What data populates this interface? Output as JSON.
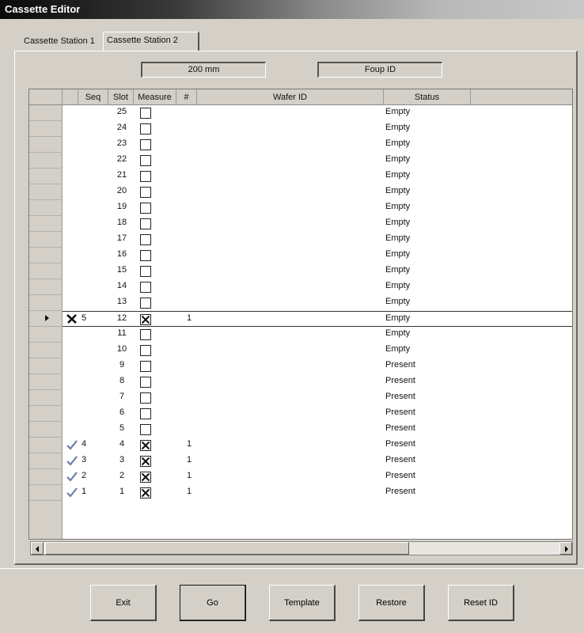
{
  "window": {
    "title": "Cassette Editor"
  },
  "tabs": [
    {
      "label": "Cassette Station 1"
    },
    {
      "label": "Cassette Station 2"
    }
  ],
  "header_fields": {
    "wafer_size": "200 mm",
    "foup_id": "Foup ID"
  },
  "grid": {
    "columns": [
      "Seq",
      "Slot",
      "Measure",
      "#",
      "Wafer ID",
      "Status"
    ],
    "rows": [
      {
        "seq_icon": "",
        "seq": "",
        "slot": "25",
        "measure": false,
        "num": "",
        "wafer_id": "",
        "status": "Empty",
        "selected": false
      },
      {
        "seq_icon": "",
        "seq": "",
        "slot": "24",
        "measure": false,
        "num": "",
        "wafer_id": "",
        "status": "Empty",
        "selected": false
      },
      {
        "seq_icon": "",
        "seq": "",
        "slot": "23",
        "measure": false,
        "num": "",
        "wafer_id": "",
        "status": "Empty",
        "selected": false
      },
      {
        "seq_icon": "",
        "seq": "",
        "slot": "22",
        "measure": false,
        "num": "",
        "wafer_id": "",
        "status": "Empty",
        "selected": false
      },
      {
        "seq_icon": "",
        "seq": "",
        "slot": "21",
        "measure": false,
        "num": "",
        "wafer_id": "",
        "status": "Empty",
        "selected": false
      },
      {
        "seq_icon": "",
        "seq": "",
        "slot": "20",
        "measure": false,
        "num": "",
        "wafer_id": "",
        "status": "Empty",
        "selected": false
      },
      {
        "seq_icon": "",
        "seq": "",
        "slot": "19",
        "measure": false,
        "num": "",
        "wafer_id": "",
        "status": "Empty",
        "selected": false
      },
      {
        "seq_icon": "",
        "seq": "",
        "slot": "18",
        "measure": false,
        "num": "",
        "wafer_id": "",
        "status": "Empty",
        "selected": false
      },
      {
        "seq_icon": "",
        "seq": "",
        "slot": "17",
        "measure": false,
        "num": "",
        "wafer_id": "",
        "status": "Empty",
        "selected": false
      },
      {
        "seq_icon": "",
        "seq": "",
        "slot": "16",
        "measure": false,
        "num": "",
        "wafer_id": "",
        "status": "Empty",
        "selected": false
      },
      {
        "seq_icon": "",
        "seq": "",
        "slot": "15",
        "measure": false,
        "num": "",
        "wafer_id": "",
        "status": "Empty",
        "selected": false
      },
      {
        "seq_icon": "",
        "seq": "",
        "slot": "14",
        "measure": false,
        "num": "",
        "wafer_id": "",
        "status": "Empty",
        "selected": false
      },
      {
        "seq_icon": "",
        "seq": "",
        "slot": "13",
        "measure": false,
        "num": "",
        "wafer_id": "",
        "status": "Empty",
        "selected": false
      },
      {
        "seq_icon": "cross",
        "seq": "5",
        "slot": "12",
        "measure": true,
        "num": "1",
        "wafer_id": "",
        "status": "Empty",
        "selected": true
      },
      {
        "seq_icon": "",
        "seq": "",
        "slot": "11",
        "measure": false,
        "num": "",
        "wafer_id": "",
        "status": "Empty",
        "selected": false
      },
      {
        "seq_icon": "",
        "seq": "",
        "slot": "10",
        "measure": false,
        "num": "",
        "wafer_id": "",
        "status": "Empty",
        "selected": false
      },
      {
        "seq_icon": "",
        "seq": "",
        "slot": "9",
        "measure": false,
        "num": "",
        "wafer_id": "",
        "status": "Present",
        "selected": false
      },
      {
        "seq_icon": "",
        "seq": "",
        "slot": "8",
        "measure": false,
        "num": "",
        "wafer_id": "",
        "status": "Present",
        "selected": false
      },
      {
        "seq_icon": "",
        "seq": "",
        "slot": "7",
        "measure": false,
        "num": "",
        "wafer_id": "",
        "status": "Present",
        "selected": false
      },
      {
        "seq_icon": "",
        "seq": "",
        "slot": "6",
        "measure": false,
        "num": "",
        "wafer_id": "",
        "status": "Present",
        "selected": false
      },
      {
        "seq_icon": "",
        "seq": "",
        "slot": "5",
        "measure": false,
        "num": "",
        "wafer_id": "",
        "status": "Present",
        "selected": false
      },
      {
        "seq_icon": "check",
        "seq": "4",
        "slot": "4",
        "measure": true,
        "num": "1",
        "wafer_id": "",
        "status": "Present",
        "selected": false
      },
      {
        "seq_icon": "check",
        "seq": "3",
        "slot": "3",
        "measure": true,
        "num": "1",
        "wafer_id": "",
        "status": "Present",
        "selected": false
      },
      {
        "seq_icon": "check",
        "seq": "2",
        "slot": "2",
        "measure": true,
        "num": "1",
        "wafer_id": "",
        "status": "Present",
        "selected": false
      },
      {
        "seq_icon": "check",
        "seq": "1",
        "slot": "1",
        "measure": true,
        "num": "1",
        "wafer_id": "",
        "status": "Present",
        "selected": false
      }
    ]
  },
  "buttons": [
    {
      "label": "Exit"
    },
    {
      "label": "Go"
    },
    {
      "label": "Template"
    },
    {
      "label": "Restore"
    },
    {
      "label": "Reset ID"
    }
  ],
  "colors": {
    "face": "#d4d0c8",
    "grid_background": "#ffffff",
    "text": "#111111"
  }
}
